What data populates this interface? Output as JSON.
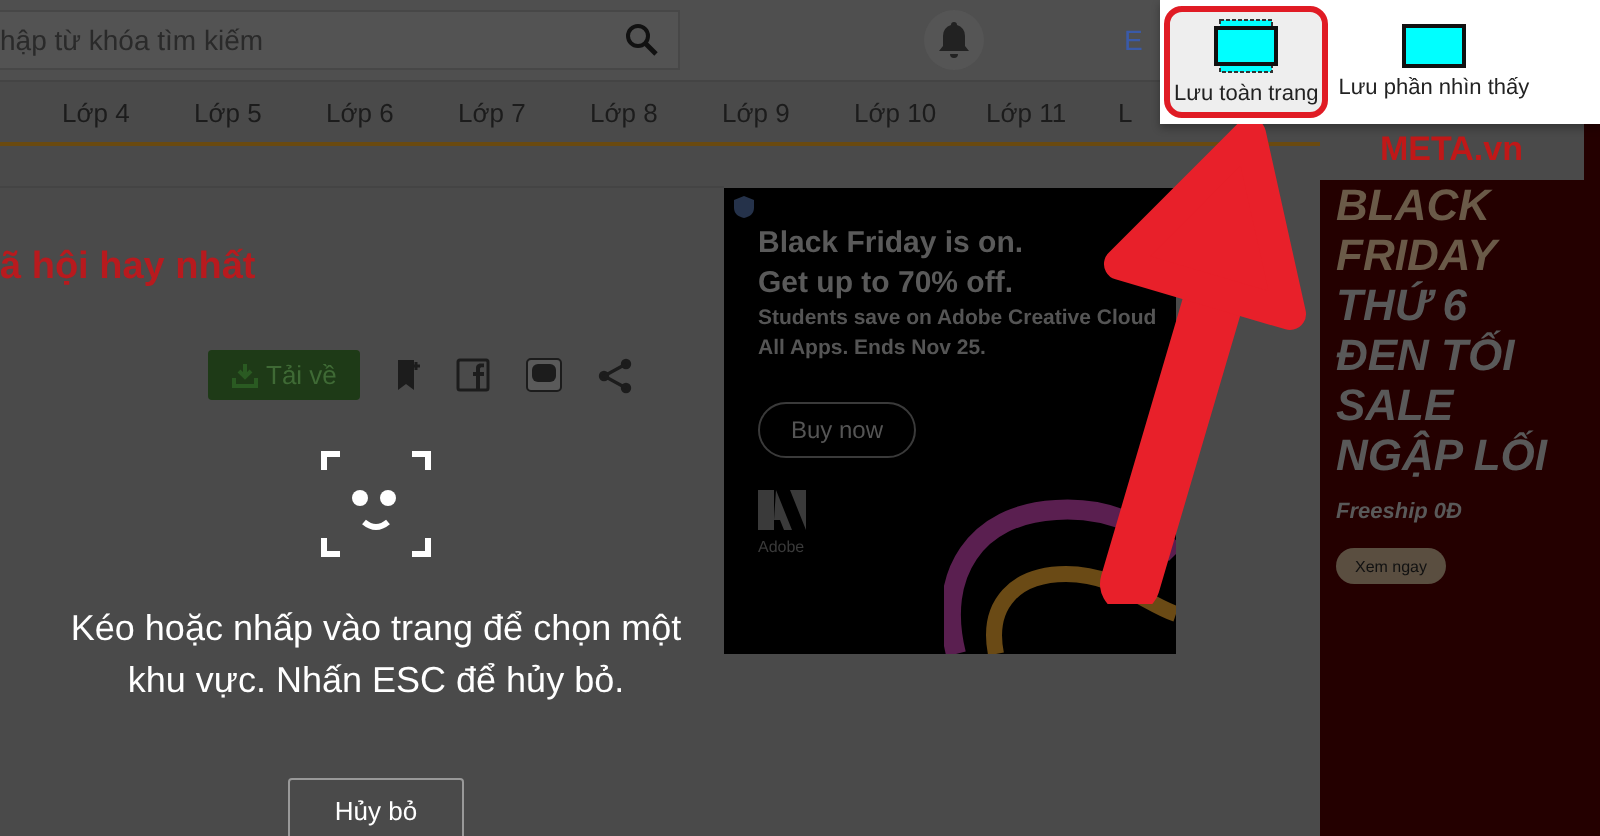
{
  "search": {
    "placeholder": "hập từ khóa tìm kiếm"
  },
  "header_link": "E",
  "nav_tabs": [
    "Lớp 4",
    "Lớp 5",
    "Lớp 6",
    "Lớp 7",
    "Lớp 8",
    "Lớp 9",
    "Lớp 10",
    "Lớp 11",
    "L"
  ],
  "article": {
    "title": "ã hội hay nhất",
    "download_button": "Tải về"
  },
  "ad": {
    "headline": [
      "Black Friday is on.",
      "Get up to 70% off."
    ],
    "subtext": [
      "Students save on Adobe Creative Cloud",
      "All Apps. Ends Nov 25."
    ],
    "button": "Buy now",
    "brand": "Adobe"
  },
  "banner": {
    "site": "META.vn",
    "lines": [
      "BLACK",
      "FRIDAY",
      "THỨ 6",
      "ĐEN TỐI",
      "SALE",
      "NGẬP LỐI"
    ],
    "freeship": "Freeship 0Đ",
    "button": "Xem ngay"
  },
  "capture_prompt": {
    "message": "Kéo hoặc nhấp vào trang để chọn một khu vực. Nhấn ESC để hủy bỏ.",
    "cancel_button": "Hủy bỏ"
  },
  "save_menu": {
    "options": [
      {
        "label": "Lưu toàn trang",
        "kind": "full",
        "selected": true
      },
      {
        "label": "Lưu phần nhìn thấy",
        "kind": "visible",
        "selected": false
      }
    ]
  }
}
